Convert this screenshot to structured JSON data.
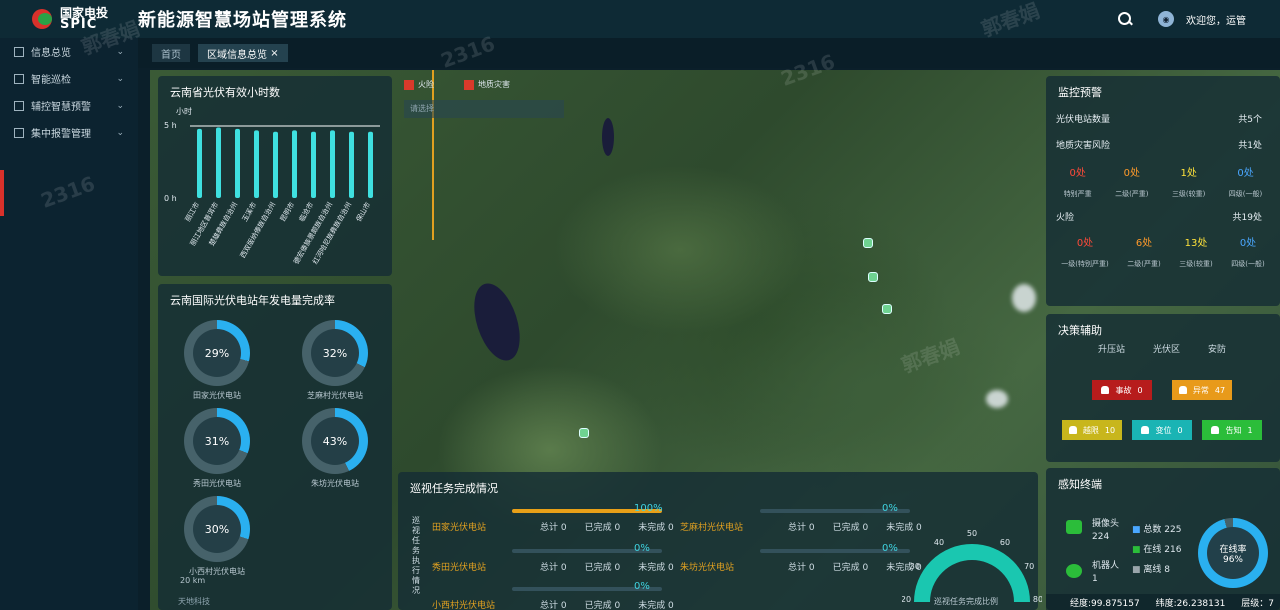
{
  "header": {
    "logo_cn": "国家电投",
    "logo_en": "SPIC",
    "title": "新能源智慧场站管理系统",
    "user": "欢迎您，运管"
  },
  "sidebar": {
    "items": [
      {
        "label": "信息总览",
        "icon": "grid-icon"
      },
      {
        "label": "智能巡检",
        "icon": "monitor-icon"
      },
      {
        "label": "辅控智慧预警",
        "icon": "chart-icon"
      },
      {
        "label": "集中报警管理",
        "icon": "alarm-icon"
      }
    ]
  },
  "tabs": [
    {
      "label": "首页",
      "active": false
    },
    {
      "label": "区域信息总览",
      "active": true
    }
  ],
  "map_legend": {
    "fire": "火险",
    "geo": "地质灾害",
    "search_placeholder": "请选择"
  },
  "hours": {
    "title": "云南省光伏有效小时数",
    "unit": "小时",
    "y_top": "5 h",
    "y_bottom": "0 h",
    "categories": [
      "丽江市",
      "丽江地区普洱市",
      "楚雄彝族自治州",
      "玉溪市",
      "西双版纳傣族自治州",
      "昆明市",
      "临沧市",
      "德宏傣族景颇族自治州",
      "红河哈尼族彝族自治州",
      "保山市"
    ],
    "values": [
      4.8,
      4.9,
      4.8,
      4.7,
      4.6,
      4.7,
      4.6,
      4.7,
      4.6,
      4.6
    ]
  },
  "rate": {
    "title": "云南国际光伏电站年发电量完成率",
    "items": [
      {
        "label": "田家光伏电站",
        "value": "29%",
        "fraction": 0.29
      },
      {
        "label": "芝麻村光伏电站",
        "value": "32%",
        "fraction": 0.32
      },
      {
        "label": "秀田光伏电站",
        "value": "31%",
        "fraction": 0.31
      },
      {
        "label": "朱坊光伏电站",
        "value": "43%",
        "fraction": 0.43
      },
      {
        "label": "小西村光伏电站",
        "value": "30%",
        "fraction": 0.3
      }
    ],
    "scale": "20 km",
    "footer": "天地科技"
  },
  "monitor": {
    "title": "监控预警",
    "station_label": "光伏电站数量",
    "station_value": "共5个",
    "geo_label": "地质灾害风险",
    "geo_value": "共1处",
    "geo": [
      {
        "v": "0处",
        "c": "#ff4a3a",
        "cap": "特别严重"
      },
      {
        "v": "0处",
        "c": "#ff9a2a",
        "cap": "二级(严重)"
      },
      {
        "v": "1处",
        "c": "#ffe23a",
        "cap": "三级(较重)"
      },
      {
        "v": "0处",
        "c": "#4aa7ff",
        "cap": "四级(一般)"
      }
    ],
    "fire_label": "火险",
    "fire_value": "共19处",
    "fire": [
      {
        "v": "0处",
        "c": "#ff4a3a",
        "cap": "一级(特别严重)"
      },
      {
        "v": "6处",
        "c": "#ff9a2a",
        "cap": "二级(严重)"
      },
      {
        "v": "13处",
        "c": "#ffe23a",
        "cap": "三级(较重)"
      },
      {
        "v": "0处",
        "c": "#4aa7ff",
        "cap": "四级(一般)"
      }
    ]
  },
  "decide": {
    "title": "决策辅助",
    "tabs": [
      "升压站",
      "光伏区",
      "安防"
    ],
    "buttons": [
      {
        "label": "事故",
        "count": "0",
        "color": "#b71c1c"
      },
      {
        "label": "异常",
        "count": "47",
        "color": "#e89a1a"
      },
      {
        "label": "越限",
        "count": "10",
        "color": "#c8b61c"
      },
      {
        "label": "变位",
        "count": "0",
        "color": "#1ab4b4"
      },
      {
        "label": "告知",
        "count": "1",
        "color": "#2bbd3a"
      }
    ]
  },
  "sense": {
    "title": "感知终端",
    "camera_label": "摄像头",
    "camera_value": "224",
    "robot_label": "机器人",
    "robot_value": "1",
    "total_label": "总数",
    "total_value": "225",
    "online_label": "在线",
    "online_value": "216",
    "offline_label": "离线",
    "offline_value": "8",
    "rate_label": "在线率",
    "rate_value": "96%",
    "rate_fraction": 0.96
  },
  "patrol": {
    "title": "巡视任务完成情况",
    "side": "巡视任务执行情况",
    "rows": [
      {
        "name": "田家光伏电站",
        "pct": "100%",
        "frac": 1.0,
        "total": "总计 0",
        "done": "已完成 0",
        "undone": "未完成 0"
      },
      {
        "name": "芝麻村光伏电站",
        "pct": "0%",
        "frac": 0,
        "total": "总计 0",
        "done": "已完成 0",
        "undone": "未完成 0"
      },
      {
        "name": "秀田光伏电站",
        "pct": "0%",
        "frac": 0,
        "total": "总计 0",
        "done": "已完成 0",
        "undone": "未完成 0"
      },
      {
        "name": "朱坊光伏电站",
        "pct": "0%",
        "frac": 0,
        "total": "总计 0",
        "done": "已完成 0",
        "undone": "未完成 0"
      },
      {
        "name": "小西村光伏电站",
        "pct": "0%",
        "frac": 0,
        "total": "总计 0",
        "done": "已完成 0",
        "undone": "未完成 0"
      }
    ],
    "gauge_ticks": [
      "20",
      "30",
      "40",
      "50",
      "60",
      "70",
      "80"
    ],
    "gauge_caption": "巡视任务完成比例"
  },
  "status": {
    "lon": "经度:99.875157",
    "lat": "纬度:26.238131",
    "level": "层级：7"
  },
  "watermarks": [
    "郭春娟",
    "2316"
  ],
  "chart_data": {
    "type": "bar",
    "title": "云南省光伏有效小时数",
    "ylabel": "小时",
    "categories": [
      "丽江市",
      "丽江地区普洱市",
      "楚雄彝族自治州",
      "玉溪市",
      "西双版纳傣族自治州",
      "昆明市",
      "临沧市",
      "德宏傣族景颇族自治州",
      "红河哈尼族彝族自治州",
      "保山市"
    ],
    "values": [
      4.8,
      4.9,
      4.8,
      4.7,
      4.6,
      4.7,
      4.6,
      4.7,
      4.6,
      4.6
    ],
    "ylim": [
      0,
      5
    ]
  }
}
